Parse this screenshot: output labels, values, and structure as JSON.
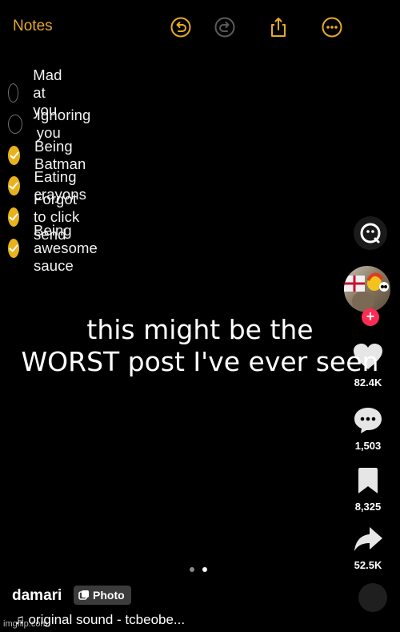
{
  "notes": {
    "title": "Notes",
    "toolbar": {
      "undo": "undo-icon",
      "redo": "redo-icon",
      "share": "share-icon",
      "more": "more-icon"
    },
    "items": [
      {
        "label": "Mad at you",
        "checked": false
      },
      {
        "label": "Ignoring you",
        "checked": false
      },
      {
        "label": "Being Batman",
        "checked": true
      },
      {
        "label": "Eating crayons",
        "checked": true
      },
      {
        "label": "Forgot to click send",
        "checked": true
      },
      {
        "label": "Being awesome sauce",
        "checked": true
      }
    ]
  },
  "caption": {
    "line1": "this might be the",
    "line2": "WORST post I've ever seen"
  },
  "actions": {
    "likes": "82.4K",
    "comments": "1,503",
    "saves": "8,325",
    "shares": "52.5K"
  },
  "post": {
    "author": "damari",
    "type_badge": "Photo",
    "sound": "♫ original sound - tcbeobe...",
    "carousel_active": 2,
    "carousel_total": 2
  },
  "watermark": "imgflip.com",
  "colors": {
    "accent": "#e7a928",
    "check_fill": "#e7b21c",
    "follow": "#fe2c55",
    "background": "#000000"
  }
}
